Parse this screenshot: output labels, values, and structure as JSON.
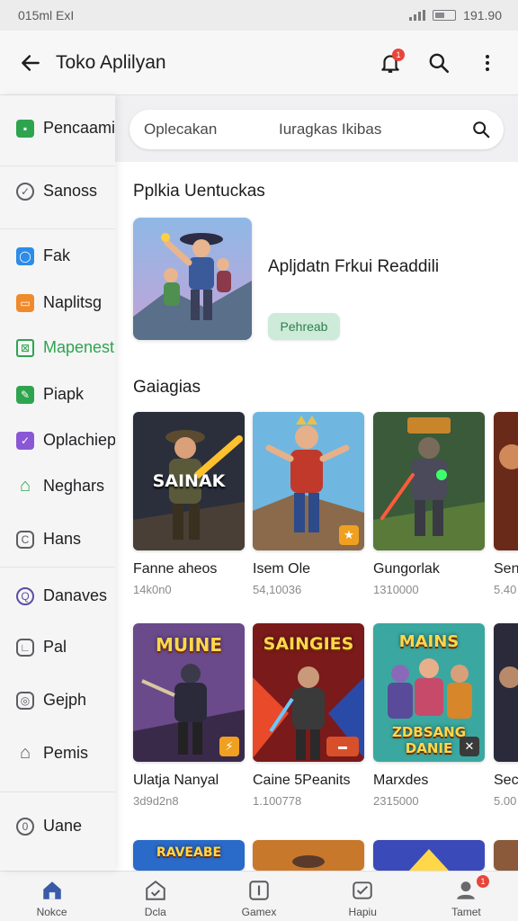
{
  "status": {
    "left": "015ml ExI",
    "time": "191.90"
  },
  "appbar": {
    "title": "Toko Aplilyan",
    "notif_count": "1"
  },
  "search": {
    "placeholder_left": "Oplecakan",
    "placeholder_right": "Iuragkas Ikibas"
  },
  "drawer": {
    "items": [
      {
        "label": "Pencaami"
      },
      {
        "label": "Sanoss"
      },
      {
        "label": "Fak"
      },
      {
        "label": "Naplitsg"
      },
      {
        "label": "Mapenest"
      },
      {
        "label": "Piapk"
      },
      {
        "label": "Oplachiep"
      },
      {
        "label": "Neghars"
      },
      {
        "label": "Hans"
      },
      {
        "label": "Danaves"
      },
      {
        "label": "Pal"
      },
      {
        "label": "Gejph"
      },
      {
        "label": "Pemis"
      },
      {
        "label": "Uane"
      }
    ]
  },
  "featured": {
    "section_title": "Pplkia Uentuckas",
    "app_name": "Apljdatn Frkui Readdili",
    "chip": "Pehreab"
  },
  "games": {
    "section_title": "Gaiagias",
    "row1": [
      {
        "name": "Fanne aheos",
        "sub": "14k0n0",
        "art": "SAINAK"
      },
      {
        "name": "Isem Ole",
        "sub": "54,10036",
        "art": ""
      },
      {
        "name": "Gungorlak",
        "sub": "1310000",
        "art": ""
      },
      {
        "name": "Sen",
        "sub": "5.40",
        "art": ""
      }
    ],
    "row2": [
      {
        "name": "Ulatja Nanyal",
        "sub": "3d9d2n8",
        "art": "MUINE"
      },
      {
        "name": "Caine 5Peanits",
        "sub": "1.100778",
        "art": "SAINGIES"
      },
      {
        "name": "Marxdes",
        "sub": "2315000",
        "art": "MAINS"
      },
      {
        "name": "Sec",
        "sub": "5.00",
        "art": ""
      }
    ],
    "row3_art": [
      "RAVEABE",
      "",
      "",
      ""
    ]
  },
  "bottom_nav": {
    "tabs": [
      {
        "label": "Nokce"
      },
      {
        "label": "Dcla"
      },
      {
        "label": "Gamex"
      },
      {
        "label": "Hapiu"
      },
      {
        "label": "Tamet",
        "badge": "1"
      }
    ]
  },
  "colors": {
    "accent_green": "#2ea44f",
    "badge_red": "#e8443a",
    "chip_bg": "#cdebd8"
  }
}
